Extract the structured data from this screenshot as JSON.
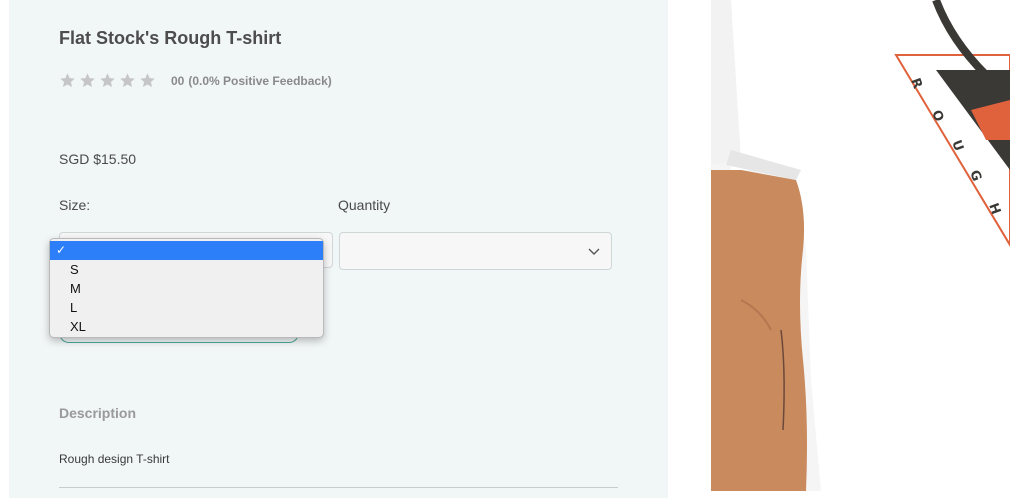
{
  "product": {
    "title": "Flat Stock's Rough T-shirt",
    "rating_count": "00",
    "rating_feedback": "(0.0% Positive Feedback)",
    "price": "SGD $15.50"
  },
  "options": {
    "size_label": "Size:",
    "quantity_label": "Quantity",
    "size_dropdown": {
      "selected_mark": "✓",
      "items": [
        "S",
        "M",
        "L",
        "XL"
      ]
    }
  },
  "description": {
    "heading": "Description",
    "text": "Rough design T-shirt"
  },
  "image": {
    "print_letters": [
      "R",
      "O",
      "U",
      "G",
      "H"
    ]
  },
  "colors": {
    "selected_option": "#2d7ff9",
    "button_border": "#4aa89a",
    "print_orange": "#e0623c"
  }
}
